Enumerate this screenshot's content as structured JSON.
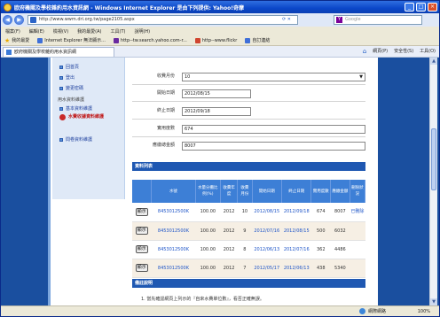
{
  "window": {
    "title": "欧府機關及學校雜約用水資訊網 - Windows Internet Explorer 是由下列提供: Yahoo!奇摩"
  },
  "address": {
    "url": "http://www.wwm.dri.org.tw/page2105.aspx",
    "search_placeholder": "Google"
  },
  "menu": [
    "檔案(F)",
    "編輯(E)",
    "檢視(V)",
    "我的最愛(A)",
    "工具(T)",
    "說明(H)"
  ],
  "favorites": {
    "label": "我的最愛",
    "items": [
      "Internet Explorer 無法顯示...",
      "http--tw.search.yahoo.com-r...",
      "http--www.flickr",
      "自訂連結"
    ]
  },
  "tab": {
    "label": "欧府機關及學校雜約用水資訊網"
  },
  "tools": [
    "網頁(P)",
    "安全性(S)",
    "工具(O)"
  ],
  "sidebar": {
    "items": [
      {
        "label": "回首頁",
        "type": "link"
      },
      {
        "label": "登出",
        "type": "link"
      },
      {
        "label": "變更密碼",
        "type": "link"
      },
      {
        "label": "用水資料維護",
        "type": "category"
      },
      {
        "label": "基本資料維護",
        "type": "link"
      },
      {
        "label": "水費收據資料維護",
        "type": "active"
      },
      {
        "label": "問卷資料維護",
        "type": "link"
      }
    ]
  },
  "form": {
    "fields": [
      {
        "label": "收費月份",
        "value": "10",
        "type": "select"
      },
      {
        "label": "開始日期",
        "value": "2012/08/15"
      },
      {
        "label": "終止日期",
        "value": "2012/09/18"
      },
      {
        "label": "實用度數",
        "value": "674"
      },
      {
        "label": "應繳總金額",
        "value": "8007"
      }
    ]
  },
  "list": {
    "title": "資料列表",
    "headers": [
      "",
      "水號",
      "水量分攤比例(%)",
      "收費年度",
      "收費月份",
      "開始日期",
      "終止日期",
      "實用度數",
      "應繳金額",
      "刪除狀況"
    ],
    "button_label": "顯示",
    "rows": [
      {
        "account": "8453012500K",
        "ratio": "100.00",
        "year": "2012",
        "month": "10",
        "start": "2012/08/15",
        "end": "2012/09/18",
        "usage": "674",
        "amount": "8007",
        "status": "已刪除"
      },
      {
        "account": "8453012500K",
        "ratio": "100.00",
        "year": "2012",
        "month": "9",
        "start": "2012/07/16",
        "end": "2012/08/15",
        "usage": "500",
        "amount": "6032",
        "status": ""
      },
      {
        "account": "8453012500K",
        "ratio": "100.00",
        "year": "2012",
        "month": "8",
        "start": "2012/06/13",
        "end": "2012/07/16",
        "usage": "362",
        "amount": "4486",
        "status": ""
      },
      {
        "account": "8453012500K",
        "ratio": "100.00",
        "year": "2012",
        "month": "7",
        "start": "2012/05/17",
        "end": "2012/06/13",
        "usage": "438",
        "amount": "5340",
        "status": ""
      }
    ]
  },
  "notes": {
    "title": "備註說明",
    "text": "1.  當先確認網頁上列示的『自來水費單位數』，看否正確無誤。"
  },
  "status": {
    "zone": "網際網路",
    "zoom": "100%"
  }
}
